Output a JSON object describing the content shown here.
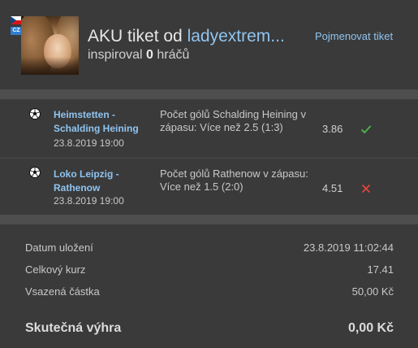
{
  "header": {
    "country_code": "CZ",
    "title_prefix": "AKU tiket od",
    "username": "ladyextrem...",
    "inspired_prefix": "inspiroval",
    "inspired_count": "0",
    "inspired_suffix": "hráčů",
    "rename_label": "Pojmenovat tiket"
  },
  "bets": [
    {
      "match": "Heimstetten - Schalding Heining",
      "date": "23.8.2019 19:00",
      "market": "Počet gólů Schalding Heining v zápasu: Více než 2.5 (1:3)",
      "odds": "3.86",
      "status_icon": "check-icon",
      "status_color": "#4caf50"
    },
    {
      "match": "Loko Leipzig - Rathenow",
      "date": "23.8.2019 19:00",
      "market": "Počet gólů Rathenow v zápasu: Více než 1.5 (2:0)",
      "odds": "4.51",
      "status_icon": "cross-icon",
      "status_color": "#e0453a"
    }
  ],
  "summary": {
    "saved_label": "Datum uložení",
    "saved_value": "23.8.2019 11:02:44",
    "total_odds_label": "Celkový kurz",
    "total_odds_value": "17.41",
    "stake_label": "Vsazená částka",
    "stake_value": "50,00 Kč",
    "win_label": "Skutečná výhra",
    "win_value": "0,00 Kč"
  },
  "colors": {
    "accent_link": "#8fc4f0",
    "background": "#3a3a3a",
    "separator": "#4e4e4e"
  }
}
